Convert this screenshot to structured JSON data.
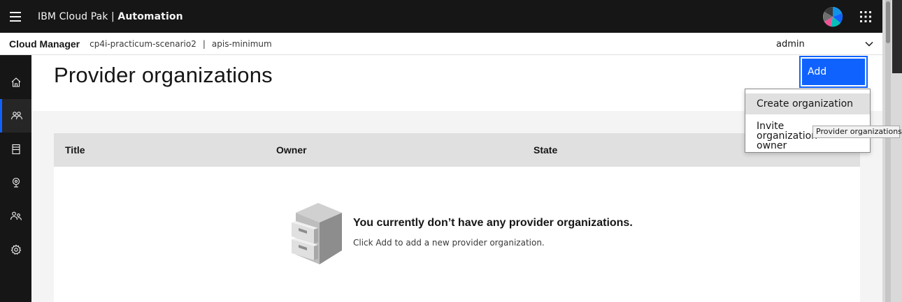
{
  "header": {
    "brand_prefix": "IBM Cloud Pak | ",
    "brand_name": "Automation"
  },
  "subheader": {
    "product": "Cloud Manager",
    "instance": "cp4i-practicum-scenario2",
    "separator": "|",
    "namespace": "apis-minimum",
    "user": "admin"
  },
  "nav": {
    "items": [
      {
        "name": "home-icon",
        "active": false
      },
      {
        "name": "provider-organizations-icon",
        "active": true
      },
      {
        "name": "resources-icon",
        "active": false
      },
      {
        "name": "topology-icon",
        "active": false
      },
      {
        "name": "members-icon",
        "active": false
      },
      {
        "name": "settings-icon",
        "active": false
      }
    ]
  },
  "page": {
    "title": "Provider organizations",
    "add_label": "Add"
  },
  "table": {
    "columns": [
      "Title",
      "Owner",
      "State"
    ]
  },
  "empty_state": {
    "title": "You currently don’t have any provider organizations.",
    "subtitle": "Click Add to add a new provider organization."
  },
  "dropdown": {
    "items": [
      "Create organization",
      "Invite organization owner"
    ]
  },
  "tooltip": {
    "text": "Provider organizations"
  },
  "colors": {
    "header_bg": "#161616",
    "accent": "#0f62fe",
    "table_header": "#e0e0e0"
  }
}
